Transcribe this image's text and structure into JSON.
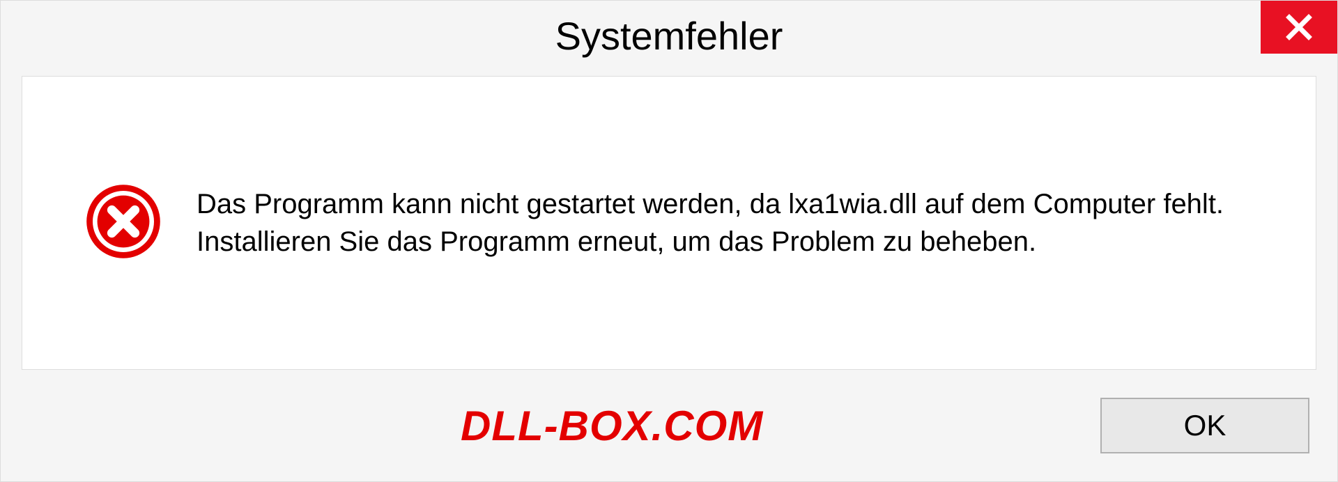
{
  "dialog": {
    "title": "Systemfehler",
    "message": "Das Programm kann nicht gestartet werden, da lxa1wia.dll auf dem Computer fehlt. Installieren Sie das Programm erneut, um das Problem zu beheben.",
    "ok_label": "OK"
  },
  "watermark": "DLL-BOX.COM"
}
